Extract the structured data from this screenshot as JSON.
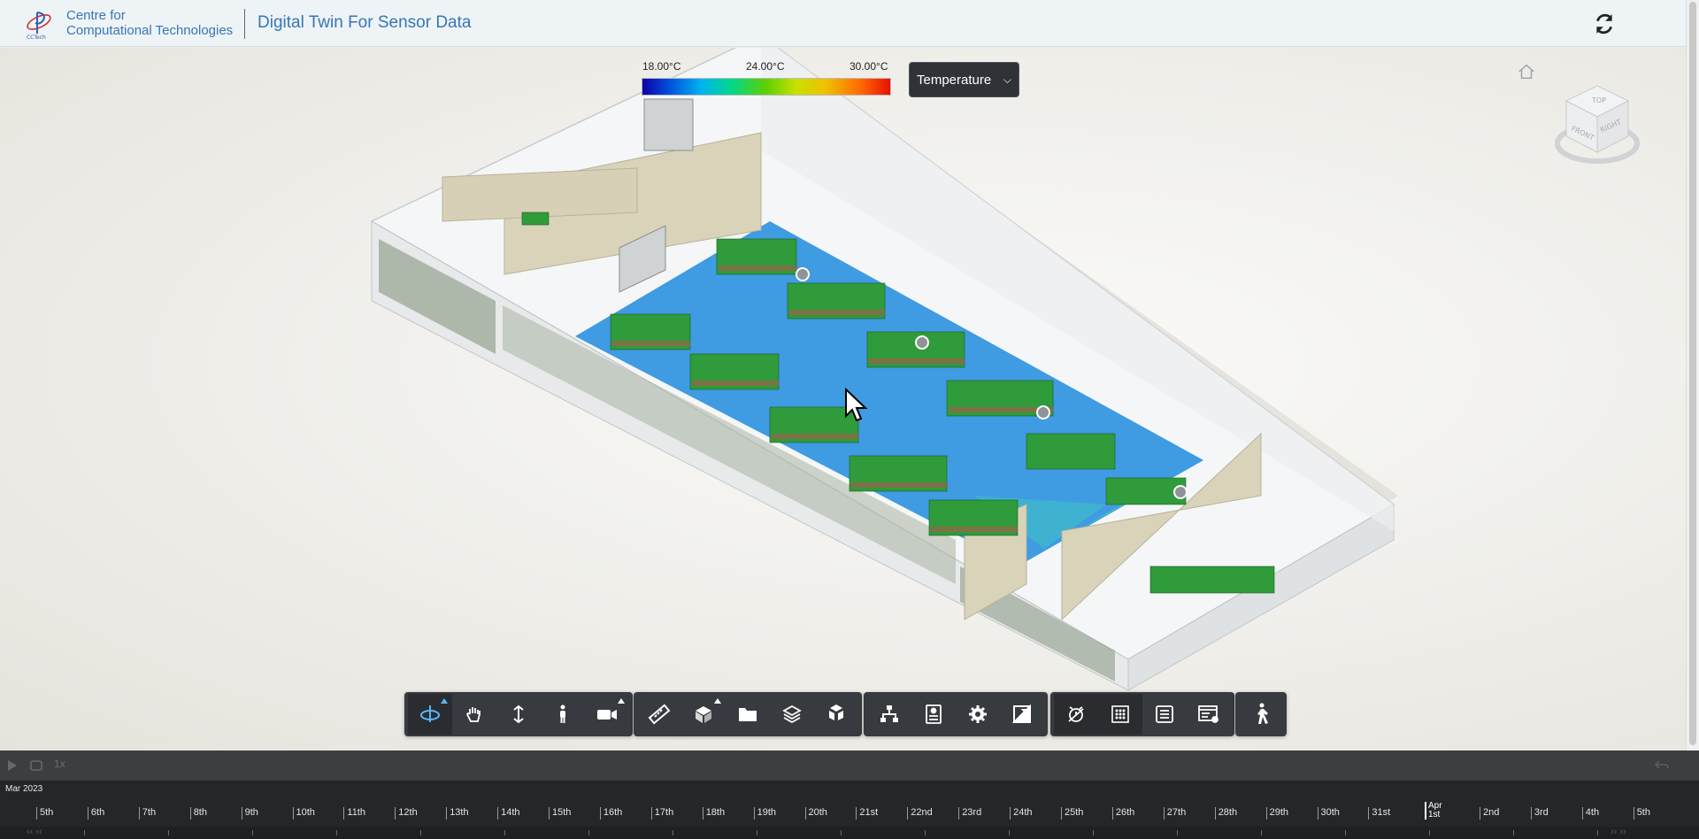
{
  "header": {
    "org_line1": "Centre for",
    "org_line2": "Computational Technologies",
    "app_title": "Digital Twin For Sensor Data"
  },
  "legend": {
    "min_label": "18.00°C",
    "mid_label": "24.00°C",
    "max_label": "30.00°C"
  },
  "metric_select": {
    "selected": "Temperature"
  },
  "toolbar": {
    "group1": [
      "orbit-icon",
      "pan-icon",
      "dolly-icon",
      "first-person-icon",
      "camera-icon"
    ],
    "group2": [
      "measure-icon",
      "section-box-icon",
      "folder-icon",
      "layers-icon",
      "explode-icon"
    ],
    "group3": [
      "model-browser-icon",
      "properties-icon",
      "settings-icon",
      "fullscreen-icon"
    ],
    "group4": [
      "sensor-toggle-icon",
      "heatmap-grid-icon",
      "list-icon",
      "panel-view-icon"
    ],
    "group5": [
      "walk-icon"
    ]
  },
  "timeline": {
    "speed": "1x",
    "month": "Mar 2023",
    "days": [
      "5th",
      "6th",
      "7th",
      "8th",
      "9th",
      "10th",
      "11th",
      "12th",
      "13th",
      "14th",
      "15th",
      "16th",
      "17th",
      "18th",
      "19th",
      "20th",
      "21st",
      "22nd",
      "23rd",
      "24th",
      "25th",
      "26th",
      "27th",
      "28th",
      "29th",
      "30th",
      "31st"
    ],
    "apr_month": "Apr",
    "apr_days": [
      "1st",
      "2nd",
      "3rd",
      "4th",
      "5th"
    ]
  },
  "colors": {
    "brand_blue": "#3676b6",
    "toolbar_bg": "#373a3e",
    "active_blue": "#5ab5ff",
    "timeline_bg": "#252628"
  }
}
